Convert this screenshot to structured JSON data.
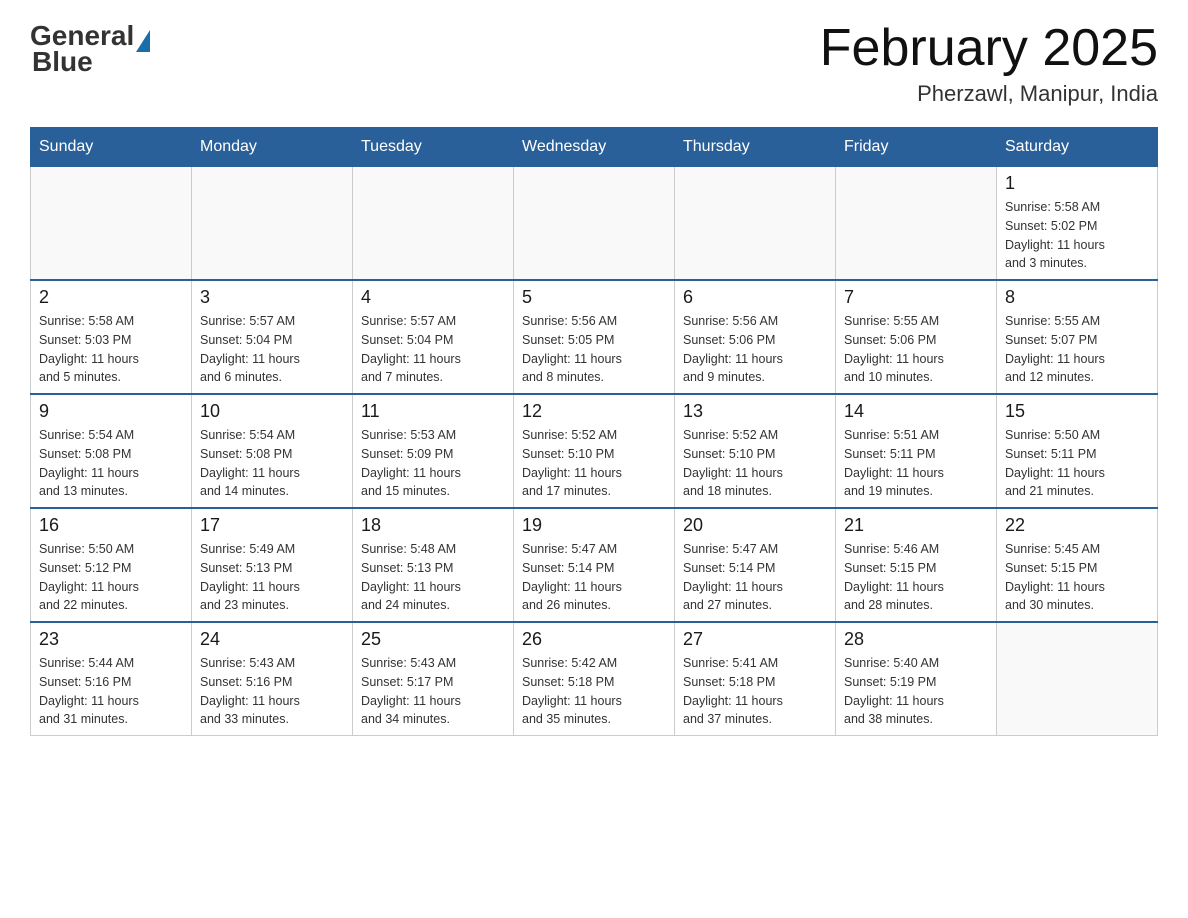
{
  "header": {
    "logo_general": "General",
    "logo_blue": "Blue",
    "title": "February 2025",
    "subtitle": "Pherzawl, Manipur, India"
  },
  "weekdays": [
    "Sunday",
    "Monday",
    "Tuesday",
    "Wednesday",
    "Thursday",
    "Friday",
    "Saturday"
  ],
  "weeks": [
    [
      {
        "day": "",
        "info": ""
      },
      {
        "day": "",
        "info": ""
      },
      {
        "day": "",
        "info": ""
      },
      {
        "day": "",
        "info": ""
      },
      {
        "day": "",
        "info": ""
      },
      {
        "day": "",
        "info": ""
      },
      {
        "day": "1",
        "info": "Sunrise: 5:58 AM\nSunset: 5:02 PM\nDaylight: 11 hours\nand 3 minutes."
      }
    ],
    [
      {
        "day": "2",
        "info": "Sunrise: 5:58 AM\nSunset: 5:03 PM\nDaylight: 11 hours\nand 5 minutes."
      },
      {
        "day": "3",
        "info": "Sunrise: 5:57 AM\nSunset: 5:04 PM\nDaylight: 11 hours\nand 6 minutes."
      },
      {
        "day": "4",
        "info": "Sunrise: 5:57 AM\nSunset: 5:04 PM\nDaylight: 11 hours\nand 7 minutes."
      },
      {
        "day": "5",
        "info": "Sunrise: 5:56 AM\nSunset: 5:05 PM\nDaylight: 11 hours\nand 8 minutes."
      },
      {
        "day": "6",
        "info": "Sunrise: 5:56 AM\nSunset: 5:06 PM\nDaylight: 11 hours\nand 9 minutes."
      },
      {
        "day": "7",
        "info": "Sunrise: 5:55 AM\nSunset: 5:06 PM\nDaylight: 11 hours\nand 10 minutes."
      },
      {
        "day": "8",
        "info": "Sunrise: 5:55 AM\nSunset: 5:07 PM\nDaylight: 11 hours\nand 12 minutes."
      }
    ],
    [
      {
        "day": "9",
        "info": "Sunrise: 5:54 AM\nSunset: 5:08 PM\nDaylight: 11 hours\nand 13 minutes."
      },
      {
        "day": "10",
        "info": "Sunrise: 5:54 AM\nSunset: 5:08 PM\nDaylight: 11 hours\nand 14 minutes."
      },
      {
        "day": "11",
        "info": "Sunrise: 5:53 AM\nSunset: 5:09 PM\nDaylight: 11 hours\nand 15 minutes."
      },
      {
        "day": "12",
        "info": "Sunrise: 5:52 AM\nSunset: 5:10 PM\nDaylight: 11 hours\nand 17 minutes."
      },
      {
        "day": "13",
        "info": "Sunrise: 5:52 AM\nSunset: 5:10 PM\nDaylight: 11 hours\nand 18 minutes."
      },
      {
        "day": "14",
        "info": "Sunrise: 5:51 AM\nSunset: 5:11 PM\nDaylight: 11 hours\nand 19 minutes."
      },
      {
        "day": "15",
        "info": "Sunrise: 5:50 AM\nSunset: 5:11 PM\nDaylight: 11 hours\nand 21 minutes."
      }
    ],
    [
      {
        "day": "16",
        "info": "Sunrise: 5:50 AM\nSunset: 5:12 PM\nDaylight: 11 hours\nand 22 minutes."
      },
      {
        "day": "17",
        "info": "Sunrise: 5:49 AM\nSunset: 5:13 PM\nDaylight: 11 hours\nand 23 minutes."
      },
      {
        "day": "18",
        "info": "Sunrise: 5:48 AM\nSunset: 5:13 PM\nDaylight: 11 hours\nand 24 minutes."
      },
      {
        "day": "19",
        "info": "Sunrise: 5:47 AM\nSunset: 5:14 PM\nDaylight: 11 hours\nand 26 minutes."
      },
      {
        "day": "20",
        "info": "Sunrise: 5:47 AM\nSunset: 5:14 PM\nDaylight: 11 hours\nand 27 minutes."
      },
      {
        "day": "21",
        "info": "Sunrise: 5:46 AM\nSunset: 5:15 PM\nDaylight: 11 hours\nand 28 minutes."
      },
      {
        "day": "22",
        "info": "Sunrise: 5:45 AM\nSunset: 5:15 PM\nDaylight: 11 hours\nand 30 minutes."
      }
    ],
    [
      {
        "day": "23",
        "info": "Sunrise: 5:44 AM\nSunset: 5:16 PM\nDaylight: 11 hours\nand 31 minutes."
      },
      {
        "day": "24",
        "info": "Sunrise: 5:43 AM\nSunset: 5:16 PM\nDaylight: 11 hours\nand 33 minutes."
      },
      {
        "day": "25",
        "info": "Sunrise: 5:43 AM\nSunset: 5:17 PM\nDaylight: 11 hours\nand 34 minutes."
      },
      {
        "day": "26",
        "info": "Sunrise: 5:42 AM\nSunset: 5:18 PM\nDaylight: 11 hours\nand 35 minutes."
      },
      {
        "day": "27",
        "info": "Sunrise: 5:41 AM\nSunset: 5:18 PM\nDaylight: 11 hours\nand 37 minutes."
      },
      {
        "day": "28",
        "info": "Sunrise: 5:40 AM\nSunset: 5:19 PM\nDaylight: 11 hours\nand 38 minutes."
      },
      {
        "day": "",
        "info": ""
      }
    ]
  ]
}
